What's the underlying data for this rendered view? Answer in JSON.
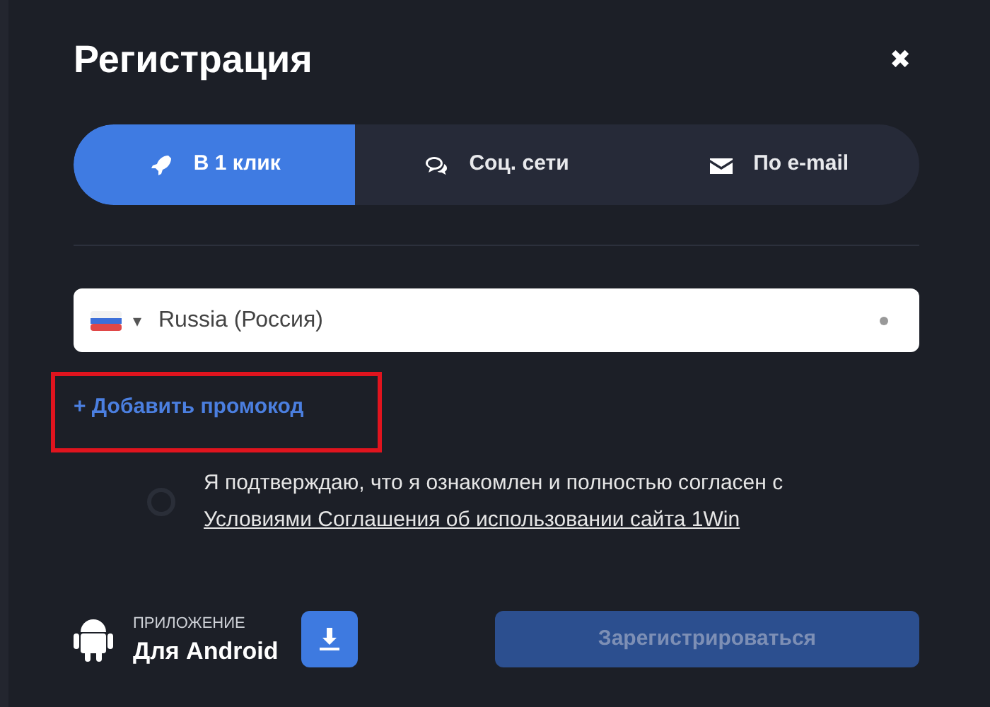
{
  "dialog": {
    "title": "Регистрация",
    "close": "✖"
  },
  "tabs": [
    {
      "label": "В 1 клик",
      "selected": true
    },
    {
      "label": "Соц. сети",
      "selected": false
    },
    {
      "label": "По e-mail",
      "selected": false
    }
  ],
  "phone": {
    "caret": "▾",
    "placeholder": "Russia (Россия)"
  },
  "promo": {
    "label": "+ Добавить промокод",
    "highlighted": true
  },
  "agreement": {
    "checked": false,
    "text": "Я подтверждаю, что я ознакомлен и полностью согласен с",
    "link": "Условиями Соглашения об использовании сайта 1Win"
  },
  "app": {
    "caption": "ПРИЛОЖЕНИЕ",
    "platform": "Для Android"
  },
  "register": {
    "label": "Зарегистрироваться",
    "disabled": true
  }
}
